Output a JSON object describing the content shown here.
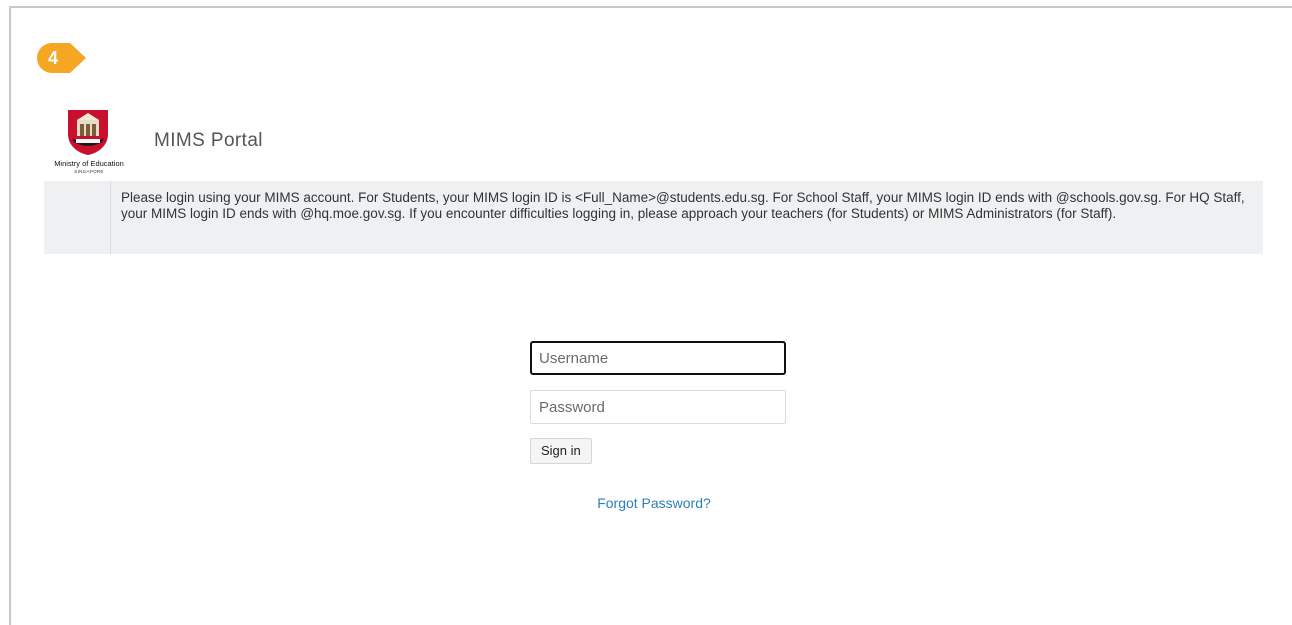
{
  "step_badge": {
    "number": "4",
    "color": "#f5a623"
  },
  "logo": {
    "name": "Ministry of Education",
    "subtitle": "SINGAPORE"
  },
  "header": {
    "title": "MIMS Portal"
  },
  "notice": {
    "text": "Please login using your MIMS account. For Students, your MIMS login ID is <Full_Name>@students.edu.sg. For School Staff, your MIMS login ID ends with @schools.gov.sg. For HQ Staff, your MIMS login ID ends with @hq.moe.gov.sg. If you encounter difficulties logging in, please approach your teachers (for Students) or MIMS Administrators (for Staff)."
  },
  "login": {
    "username_placeholder": "Username",
    "username_value": "",
    "password_placeholder": "Password",
    "password_value": "",
    "signin_label": "Sign in",
    "forgot_label": "Forgot Password?"
  },
  "colors": {
    "notice_bg": "#eef0f2",
    "link": "#2a7fbf",
    "badge": "#f5a623",
    "crest_red": "#c8102e"
  }
}
